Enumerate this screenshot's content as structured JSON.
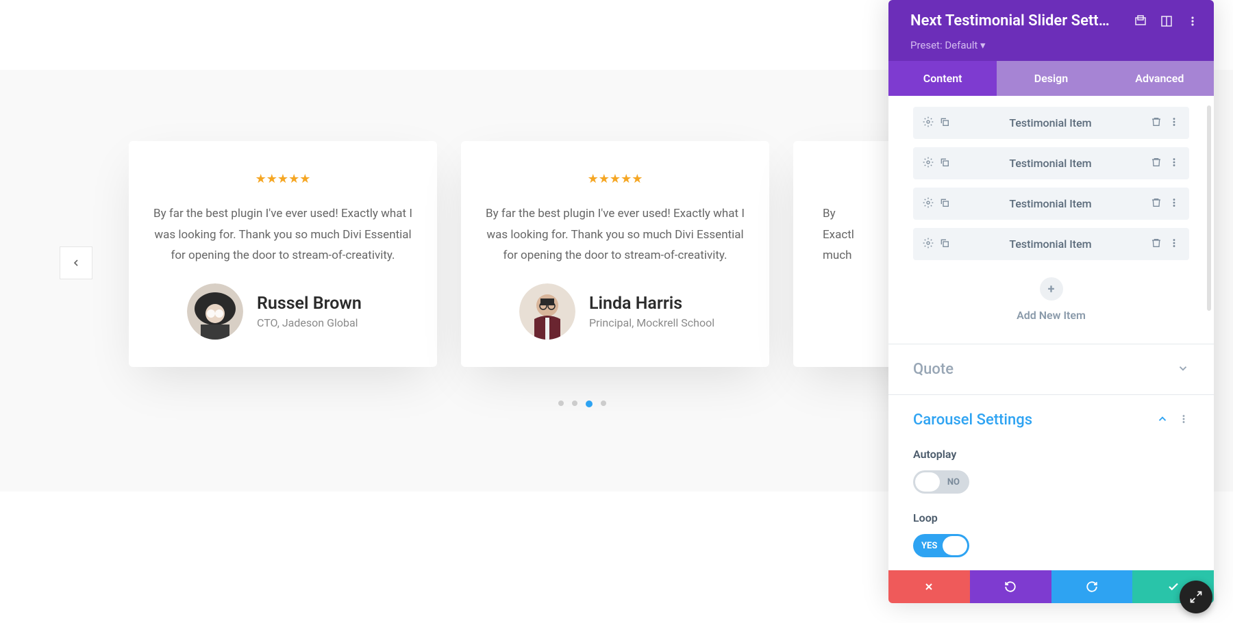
{
  "testimonials": [
    {
      "quote": "By far the best plugin I've ever used! Exactly what I was looking for. Thank you so much Divi Essential for opening the door to stream-of-creativity.",
      "name": "Russel Brown",
      "role": "CTO, Jadeson Global"
    },
    {
      "quote": "By far the best plugin I've ever used! Exactly what I was looking for. Thank you so much Divi Essential for opening the door to stream-of-creativity.",
      "name": "Linda Harris",
      "role": "Principal, Mockrell School"
    },
    {
      "quote_partial_1": "By",
      "quote_partial_2": "Exactl",
      "quote_partial_3": "much"
    }
  ],
  "panel": {
    "title": "Next Testimonial Slider Sett…",
    "preset": "Preset: Default ▾",
    "tabs": {
      "content": "Content",
      "design": "Design",
      "advanced": "Advanced"
    },
    "items": [
      {
        "label": "Testimonial Item"
      },
      {
        "label": "Testimonial Item"
      },
      {
        "label": "Testimonial Item"
      },
      {
        "label": "Testimonial Item"
      }
    ],
    "addNew": "Add New Item",
    "sections": {
      "quote": "Quote",
      "carousel": "Carousel Settings"
    },
    "settings": {
      "autoplay": {
        "label": "Autoplay",
        "value": "NO"
      },
      "loop": {
        "label": "Loop",
        "value": "YES"
      }
    }
  }
}
